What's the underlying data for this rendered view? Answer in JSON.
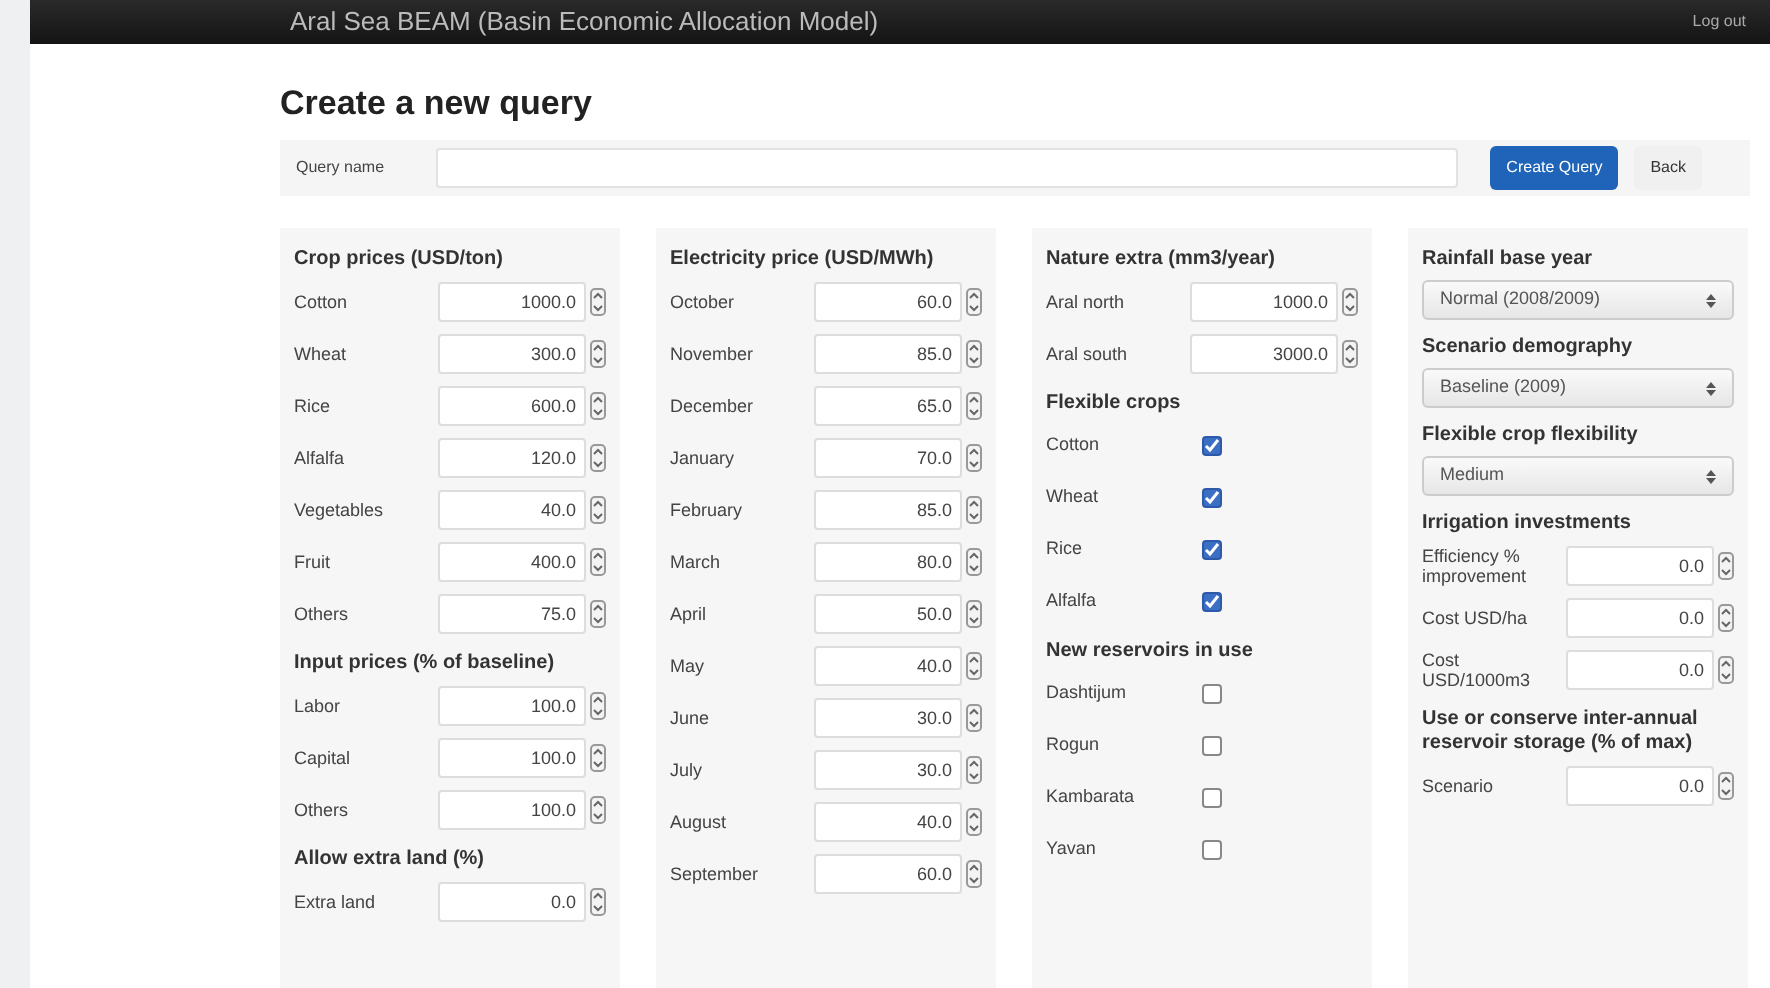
{
  "navbar": {
    "title": "Aral Sea BEAM (Basin Economic Allocation Model)",
    "link": "Log out"
  },
  "page_title": "Create a new query",
  "query": {
    "label": "Query name",
    "create_button": "Create Query",
    "back_button": "Back"
  },
  "panels": [
    {
      "items": [
        {
          "kind": "heading",
          "text": "Crop prices (USD/ton)"
        },
        {
          "kind": "number",
          "label": "Cotton",
          "value": "1000.0"
        },
        {
          "kind": "number",
          "label": "Wheat",
          "value": "300.0"
        },
        {
          "kind": "number",
          "label": "Rice",
          "value": "600.0"
        },
        {
          "kind": "number",
          "label": "Alfalfa",
          "value": "120.0"
        },
        {
          "kind": "number",
          "label": "Vegetables",
          "value": "40.0"
        },
        {
          "kind": "number",
          "label": "Fruit",
          "value": "400.0"
        },
        {
          "kind": "number",
          "label": "Others",
          "value": "75.0"
        },
        {
          "kind": "heading",
          "text": "Input prices (% of baseline)"
        },
        {
          "kind": "number",
          "label": "Labor",
          "value": "100.0"
        },
        {
          "kind": "number",
          "label": "Capital",
          "value": "100.0"
        },
        {
          "kind": "number",
          "label": "Others",
          "value": "100.0"
        },
        {
          "kind": "heading",
          "text": "Allow extra land (%)"
        },
        {
          "kind": "number",
          "label": "Extra land",
          "value": "0.0"
        }
      ]
    },
    {
      "items": [
        {
          "kind": "heading",
          "text": "Electricity price (USD/MWh)"
        },
        {
          "kind": "number",
          "label": "October",
          "value": "60.0"
        },
        {
          "kind": "number",
          "label": "November",
          "value": "85.0"
        },
        {
          "kind": "number",
          "label": "December",
          "value": "65.0"
        },
        {
          "kind": "number",
          "label": "January",
          "value": "70.0"
        },
        {
          "kind": "number",
          "label": "February",
          "value": "85.0"
        },
        {
          "kind": "number",
          "label": "March",
          "value": "80.0"
        },
        {
          "kind": "number",
          "label": "April",
          "value": "50.0"
        },
        {
          "kind": "number",
          "label": "May",
          "value": "40.0"
        },
        {
          "kind": "number",
          "label": "June",
          "value": "30.0"
        },
        {
          "kind": "number",
          "label": "July",
          "value": "30.0"
        },
        {
          "kind": "number",
          "label": "August",
          "value": "40.0"
        },
        {
          "kind": "number",
          "label": "September",
          "value": "60.0"
        }
      ]
    },
    {
      "items": [
        {
          "kind": "heading",
          "text": "Nature extra (mm3/year)"
        },
        {
          "kind": "number",
          "label": "Aral north",
          "value": "1000.0"
        },
        {
          "kind": "number",
          "label": "Aral south",
          "value": "3000.0"
        },
        {
          "kind": "heading",
          "text": "Flexible crops"
        },
        {
          "kind": "checkbox",
          "label": "Cotton",
          "checked": true
        },
        {
          "kind": "checkbox",
          "label": "Wheat",
          "checked": true
        },
        {
          "kind": "checkbox",
          "label": "Rice",
          "checked": true
        },
        {
          "kind": "checkbox",
          "label": "Alfalfa",
          "checked": true
        },
        {
          "kind": "heading",
          "text": "New reservoirs in use"
        },
        {
          "kind": "checkbox",
          "label": "Dashtijum",
          "checked": false
        },
        {
          "kind": "checkbox",
          "label": "Rogun",
          "checked": false
        },
        {
          "kind": "checkbox",
          "label": "Kambarata",
          "checked": false
        },
        {
          "kind": "checkbox",
          "label": "Yavan",
          "checked": false
        }
      ]
    },
    {
      "items": [
        {
          "kind": "heading",
          "text": "Rainfall base year"
        },
        {
          "kind": "select",
          "value": "Normal (2008/2009)"
        },
        {
          "kind": "heading",
          "text": "Scenario demography"
        },
        {
          "kind": "select",
          "value": "Baseline (2009)"
        },
        {
          "kind": "heading",
          "text": "Flexible crop flexibility"
        },
        {
          "kind": "select",
          "value": "Medium"
        },
        {
          "kind": "heading",
          "text": "Irrigation investments"
        },
        {
          "kind": "number",
          "label": "Efficiency % improvement",
          "value": "0.0"
        },
        {
          "kind": "number",
          "label": "Cost USD/ha",
          "value": "0.0"
        },
        {
          "kind": "number",
          "label": "Cost USD/1000m3",
          "value": "0.0"
        },
        {
          "kind": "heading",
          "text": "Use or conserve inter-annual reservoir storage (% of max)"
        },
        {
          "kind": "number",
          "label": "Scenario",
          "value": "0.0"
        }
      ]
    }
  ]
}
